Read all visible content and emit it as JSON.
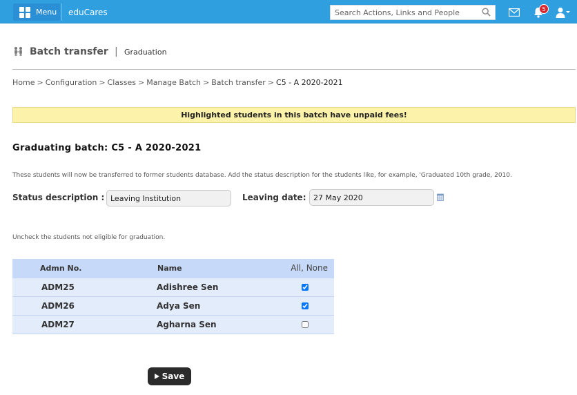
{
  "topbar": {
    "menu_label": "Menu",
    "brand": "eduCares",
    "search_placeholder": "Search Actions, Links and People",
    "notification_count": "5",
    "icons": [
      "grid-icon",
      "search-icon",
      "mail-icon",
      "bell-icon",
      "user-icon"
    ]
  },
  "page": {
    "title": "Batch transfer",
    "separator": "|",
    "subtitle": "Graduation"
  },
  "breadcrumb": {
    "items": [
      "Home",
      "Configuration",
      "Classes",
      "Manage Batch",
      "Batch transfer"
    ],
    "separator": ">",
    "current": "C5 - A 2020-2021"
  },
  "alert": {
    "text": "Highlighted students in this batch have unpaid fees!",
    "color": "#fcf2a9"
  },
  "graduating": {
    "title": "Graduating batch: C5 - A 2020-2021",
    "info": "These students will now be transferred to former students database. Add the status description for the students like, for example, 'Graduated 10th grade, 2010."
  },
  "form": {
    "status_label": "Status description :",
    "status_value": "Leaving Institution",
    "date_label": "Leaving date:",
    "date_value": "27 May 2020"
  },
  "uncheck_note": "Uncheck the students not eligible for graduation.",
  "table": {
    "headers": {
      "admn": "Admn No.",
      "name": "Name",
      "all_none": "All, None"
    },
    "rows": [
      {
        "admn": "ADM25",
        "name": "Adishree Sen",
        "checked": true
      },
      {
        "admn": "ADM26",
        "name": "Adya Sen",
        "checked": true
      },
      {
        "admn": "ADM27",
        "name": "Agharna Sen",
        "checked": false
      }
    ]
  },
  "save_label": "Save",
  "colors": {
    "topbar": "#2f9fe0",
    "table_header": "#c6d9f8",
    "table_row": "#e2ecfb",
    "save_button": "#2b2b2b"
  }
}
